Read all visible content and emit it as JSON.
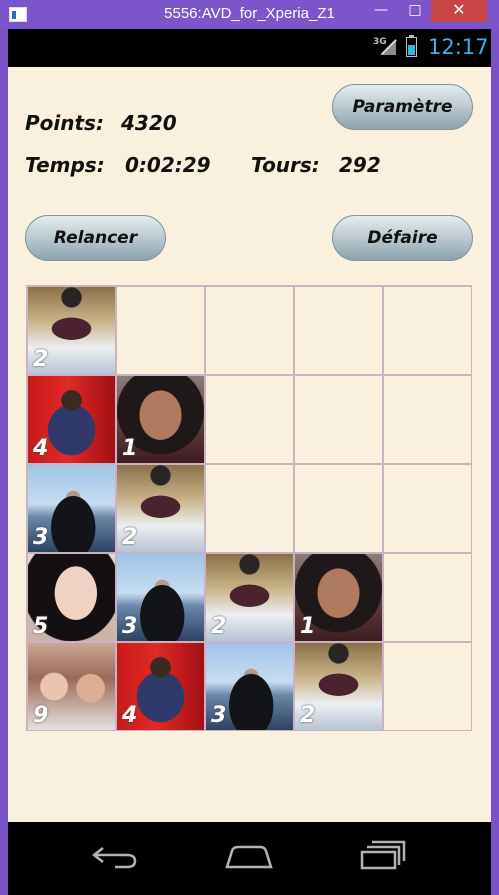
{
  "window": {
    "title": "5556:AVD_for_Xperia_Z1",
    "minimize": "—",
    "maximize": "□",
    "close": "✕"
  },
  "status_bar": {
    "network": "3G",
    "time": "12:17"
  },
  "game": {
    "points_label": "Points:",
    "points_value": "4320",
    "time_label": "Temps:",
    "time_value": "0:02:29",
    "turns_label": "Tours:",
    "turns_value": "292",
    "buttons": {
      "settings": "Paramètre",
      "restart": "Relancer",
      "undo": "Défaire"
    }
  },
  "board": {
    "rows": [
      [
        {
          "value": "2",
          "photo": "man-in-snow"
        },
        null,
        null,
        null,
        null
      ],
      [
        {
          "value": "4",
          "photo": "woman-red-chair"
        },
        {
          "value": "1",
          "photo": "girl-selfie"
        },
        null,
        null,
        null
      ],
      [
        {
          "value": "3",
          "photo": "man-harbor"
        },
        {
          "value": "2",
          "photo": "man-in-snow"
        },
        null,
        null,
        null
      ],
      [
        {
          "value": "5",
          "photo": "girl-closeup"
        },
        {
          "value": "3",
          "photo": "man-harbor"
        },
        {
          "value": "2",
          "photo": "man-in-snow"
        },
        {
          "value": "1",
          "photo": "girl-selfie"
        },
        null
      ],
      [
        {
          "value": "9",
          "photo": "two-women-hats"
        },
        {
          "value": "4",
          "photo": "woman-red-chair"
        },
        {
          "value": "3",
          "photo": "man-harbor"
        },
        {
          "value": "2",
          "photo": "man-in-snow"
        },
        null
      ]
    ]
  },
  "nav": {
    "back_icon": "back-icon",
    "home_icon": "home-icon",
    "recents_icon": "recents-icon"
  }
}
